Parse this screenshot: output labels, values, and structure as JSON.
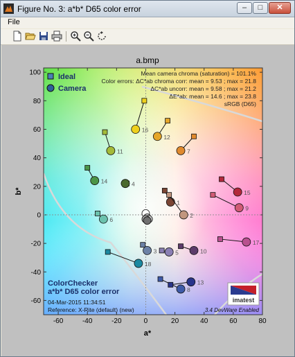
{
  "window": {
    "title": "Figure No. 3: a*b* D65 color error",
    "buttons": {
      "minimize": "–",
      "maximize": "□",
      "close": "✕"
    }
  },
  "menu": {
    "file": "File"
  },
  "toolbar": {
    "items": [
      {
        "icon": "new-icon"
      },
      {
        "icon": "open-icon"
      },
      {
        "icon": "save-icon"
      },
      {
        "icon": "print-icon"
      },
      {
        "icon": "zoom-in-icon"
      },
      {
        "icon": "zoom-out-icon"
      },
      {
        "icon": "rotate-icon"
      }
    ]
  },
  "plot": {
    "title": "a.bmp",
    "xlabel": "a*",
    "ylabel": "b*",
    "legend": {
      "ideal": "Ideal",
      "camera": "Camera"
    },
    "stats": [
      "Mean camera chroma (saturation) = 101.1%",
      "Color errors: ΔC*ab chroma corr:  mean = 9.53 ;  max = 21.8",
      "ΔC*ab uncorr:  mean = 9.58 ;  max = 21.2",
      "ΔE*ab:  mean = 14.6 ;  max = 23.8",
      "sRGB (D65)"
    ],
    "info": {
      "line1": "ColorChecker",
      "line2": "a*b* D65 color error",
      "date": "04-Mar-2015 11:34:51",
      "reference": "Reference: X-Rite (default) (new)",
      "version": "3.4  DevWare Enabled",
      "logo": "imatest"
    },
    "colors": {
      "ideal_square_fill": "#4a7fb7",
      "camera_circle_fill": "#2e5f9a",
      "gamut_line": "#d7d7d7"
    }
  },
  "chart_data": {
    "type": "scatter",
    "title": "a.bmp",
    "xlabel": "a*",
    "ylabel": "b*",
    "xlim": [
      -70,
      80
    ],
    "ylim": [
      -70,
      103
    ],
    "xticks": [
      -60,
      -40,
      -20,
      0,
      20,
      40,
      60,
      80
    ],
    "yticks": [
      -60,
      -40,
      -20,
      0,
      20,
      40,
      60,
      80,
      100
    ],
    "grid": false,
    "legend_position": "top-left",
    "series": [
      {
        "name": "Ideal",
        "marker": "square"
      },
      {
        "name": "Camera",
        "marker": "circle"
      }
    ],
    "patches": [
      {
        "label": "1",
        "ideal": [
          13,
          17
        ],
        "camera": [
          17,
          9
        ],
        "color": "#7a4433"
      },
      {
        "label": "2",
        "ideal": [
          16,
          14
        ],
        "camera": [
          26,
          0
        ],
        "color": "#c2967f"
      },
      {
        "label": "3",
        "ideal": [
          -2,
          -21
        ],
        "camera": [
          1,
          -25
        ],
        "color": "#6c81a6"
      },
      {
        "label": "4",
        "ideal": [
          -13,
          22
        ],
        "camera": [
          -14,
          22
        ],
        "color": "#4a6a2e"
      },
      {
        "label": "5",
        "ideal": [
          11,
          -25
        ],
        "camera": [
          16,
          -26
        ],
        "color": "#8a7fb3"
      },
      {
        "label": "6",
        "ideal": [
          -33,
          1
        ],
        "camera": [
          -29,
          -3
        ],
        "color": "#6bc2ad"
      },
      {
        "label": "7",
        "ideal": [
          33,
          55
        ],
        "camera": [
          24,
          45
        ],
        "color": "#e08a2e"
      },
      {
        "label": "8",
        "ideal": [
          10,
          -45
        ],
        "camera": [
          24,
          -52
        ],
        "color": "#3e5aa8"
      },
      {
        "label": "9",
        "ideal": [
          46,
          14
        ],
        "camera": [
          64,
          5
        ],
        "color": "#d05b75"
      },
      {
        "label": "10",
        "ideal": [
          24,
          -22
        ],
        "camera": [
          33,
          -25
        ],
        "color": "#5c3b6a"
      },
      {
        "label": "11",
        "ideal": [
          -28,
          58
        ],
        "camera": [
          -24,
          45
        ],
        "color": "#a4bb39"
      },
      {
        "label": "12",
        "ideal": [
          15,
          66
        ],
        "camera": [
          8,
          55
        ],
        "color": "#e5a62a"
      },
      {
        "label": "13",
        "ideal": [
          17,
          -49
        ],
        "camera": [
          31,
          -47
        ],
        "color": "#29348a"
      },
      {
        "label": "14",
        "ideal": [
          -40,
          33
        ],
        "camera": [
          -35,
          24
        ],
        "color": "#4b9547"
      },
      {
        "label": "15",
        "ideal": [
          52,
          25
        ],
        "camera": [
          63,
          16
        ],
        "color": "#b3283a"
      },
      {
        "label": "16",
        "ideal": [
          -1,
          80
        ],
        "camera": [
          -7,
          60
        ],
        "color": "#eed01d"
      },
      {
        "label": "17",
        "ideal": [
          51,
          -17
        ],
        "camera": [
          69,
          -19
        ],
        "color": "#b8508f"
      },
      {
        "label": "18",
        "ideal": [
          -26,
          -26
        ],
        "camera": [
          -5,
          -34
        ],
        "color": "#1c89a1"
      }
    ],
    "neutral_points": [
      [
        0,
        1
      ],
      [
        1,
        -2
      ],
      [
        2,
        -3
      ],
      [
        0,
        -3
      ],
      [
        1,
        -4
      ]
    ]
  }
}
